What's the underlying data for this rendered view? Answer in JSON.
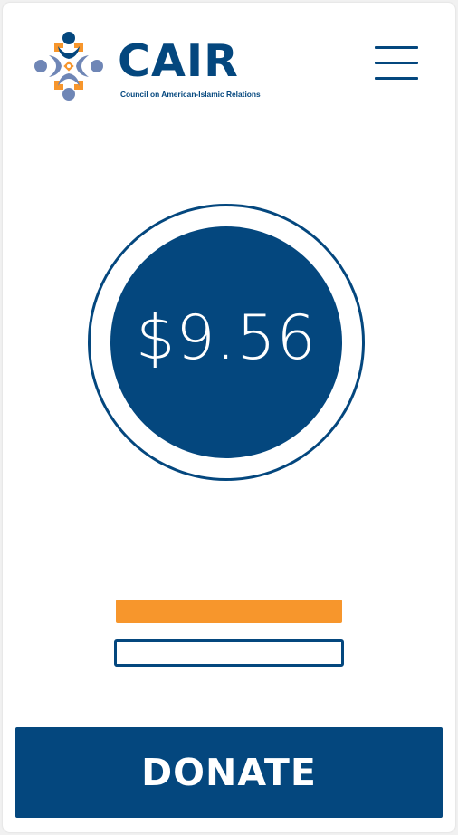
{
  "header": {
    "logo": {
      "wordmark": "CAIR",
      "tagline": "Council on American-Islamic Relations",
      "icon": "cair-emblem-icon"
    },
    "menu_icon": "hamburger-menu-icon"
  },
  "amount": {
    "value": "$9.56"
  },
  "progress_bars": [
    {
      "color": "#f7962c",
      "filled": true
    },
    {
      "color": "#04477e",
      "filled": false
    }
  ],
  "donate_button": {
    "label": "DONATE"
  },
  "colors": {
    "brand_blue": "#04477e",
    "accent_orange": "#f7962c",
    "light_blue": "#6f86b6",
    "background": "#ffffff"
  }
}
